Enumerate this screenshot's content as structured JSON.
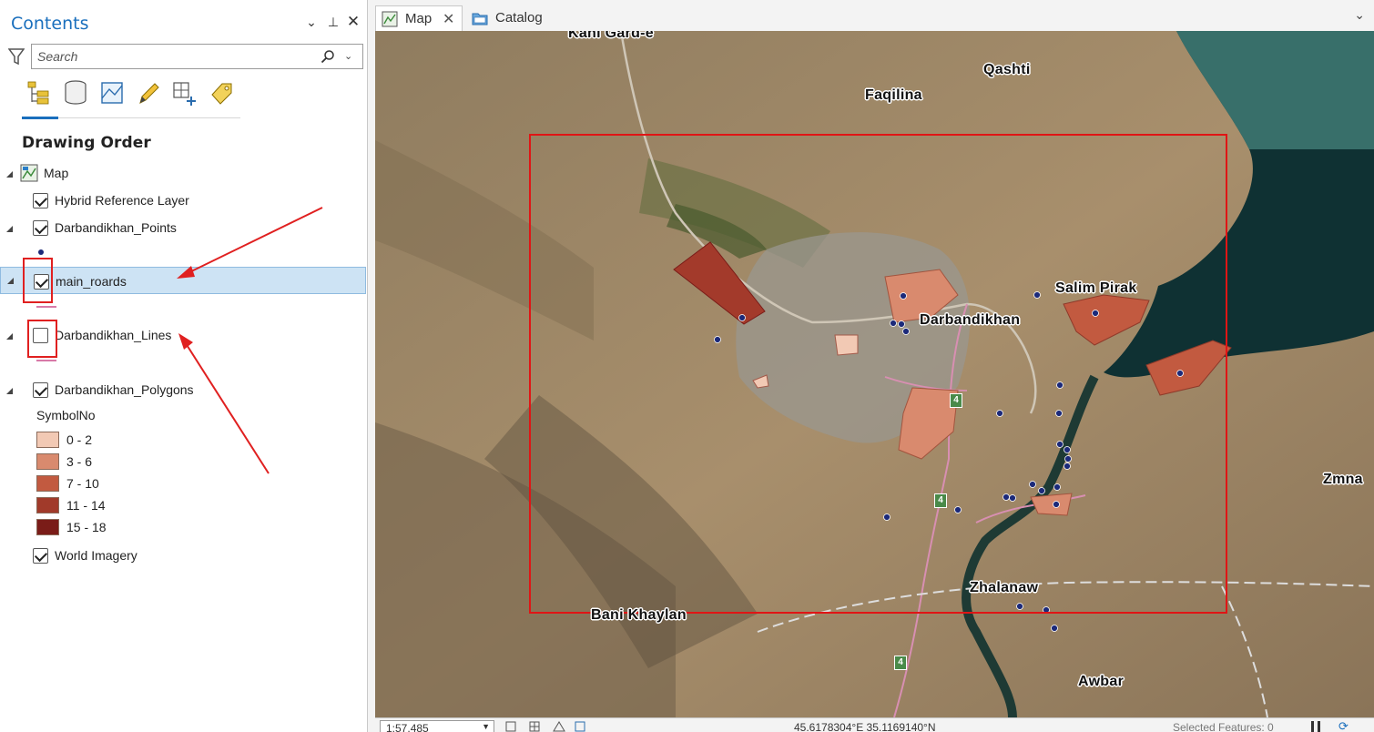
{
  "contents": {
    "title": "Contents",
    "search_placeholder": "Search",
    "section_title": "Drawing Order",
    "map_node": "Map",
    "layers": [
      {
        "label": "Hybrid Reference Layer",
        "checked": true
      },
      {
        "label": "Darbandikhan_Points",
        "checked": true
      },
      {
        "label": "main_roards",
        "checked": true,
        "selected": true
      },
      {
        "label": "Darbandikhan_Lines",
        "checked": false
      },
      {
        "label": "Darbandikhan_Polygons",
        "checked": true
      },
      {
        "label": "World Imagery",
        "checked": true
      }
    ],
    "legend": {
      "field": "SymbolNo",
      "classes": [
        {
          "label": "0 - 2",
          "color": "#f2c9b4"
        },
        {
          "label": "3 - 6",
          "color": "#d98a6e"
        },
        {
          "label": "7 - 10",
          "color": "#c25a40"
        },
        {
          "label": "11 - 14",
          "color": "#a13a2a"
        },
        {
          "label": "15 - 18",
          "color": "#7a1c18"
        }
      ]
    }
  },
  "tabs": [
    {
      "label": "Map",
      "icon": "map-icon"
    },
    {
      "label": "Catalog",
      "icon": "catalog-icon"
    }
  ],
  "map": {
    "places": [
      "Kani Gard-e",
      "Qashti",
      "Faqilina",
      "Darbandikhan",
      "Salim Pirak",
      "Zmna",
      "Zhalanaw",
      "Bani Khaylan",
      "Awbar"
    ],
    "road_shield": "4"
  },
  "status": {
    "scale": "1:57,485",
    "coordinates": "45.6178304°E 35.1169140°N",
    "selected_features": "Selected Features: 0"
  },
  "colors": {
    "accent": "#1a6fbd",
    "annotation_red": "#e02020",
    "points": "#1c2a7a",
    "road_line": "#d87aa8"
  }
}
